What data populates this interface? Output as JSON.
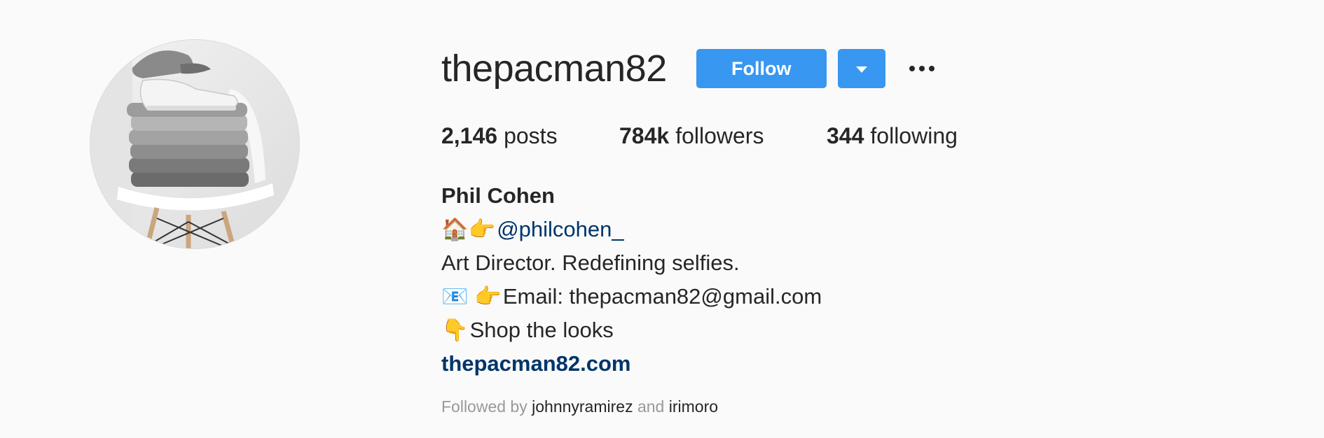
{
  "profile": {
    "username": "thepacman82",
    "follow_label": "Follow",
    "dropdown_icon": "chevron-down-icon",
    "more_icon": "more-options-icon",
    "accent_color": "#3897f0"
  },
  "stats": {
    "posts_count": "2,146",
    "posts_label": "posts",
    "followers_count": "784k",
    "followers_label": "followers",
    "following_count": "344",
    "following_label": "following"
  },
  "bio": {
    "name": "Phil Cohen",
    "line1_emojis": "🏠👉",
    "line1_mention": "@philcohen_",
    "line2": "Art Director. Redefining selfies.",
    "line3_emojis": "📧 👉",
    "line3_text": "Email: thepacman82@gmail.com",
    "line4_emoji": "👇",
    "line4_text": "Shop the looks",
    "website": "thepacman82.com"
  },
  "followed_by": {
    "prefix": "Followed by",
    "user1": "johnnyramirez",
    "conjunction": "and",
    "user2": "irimoro"
  }
}
